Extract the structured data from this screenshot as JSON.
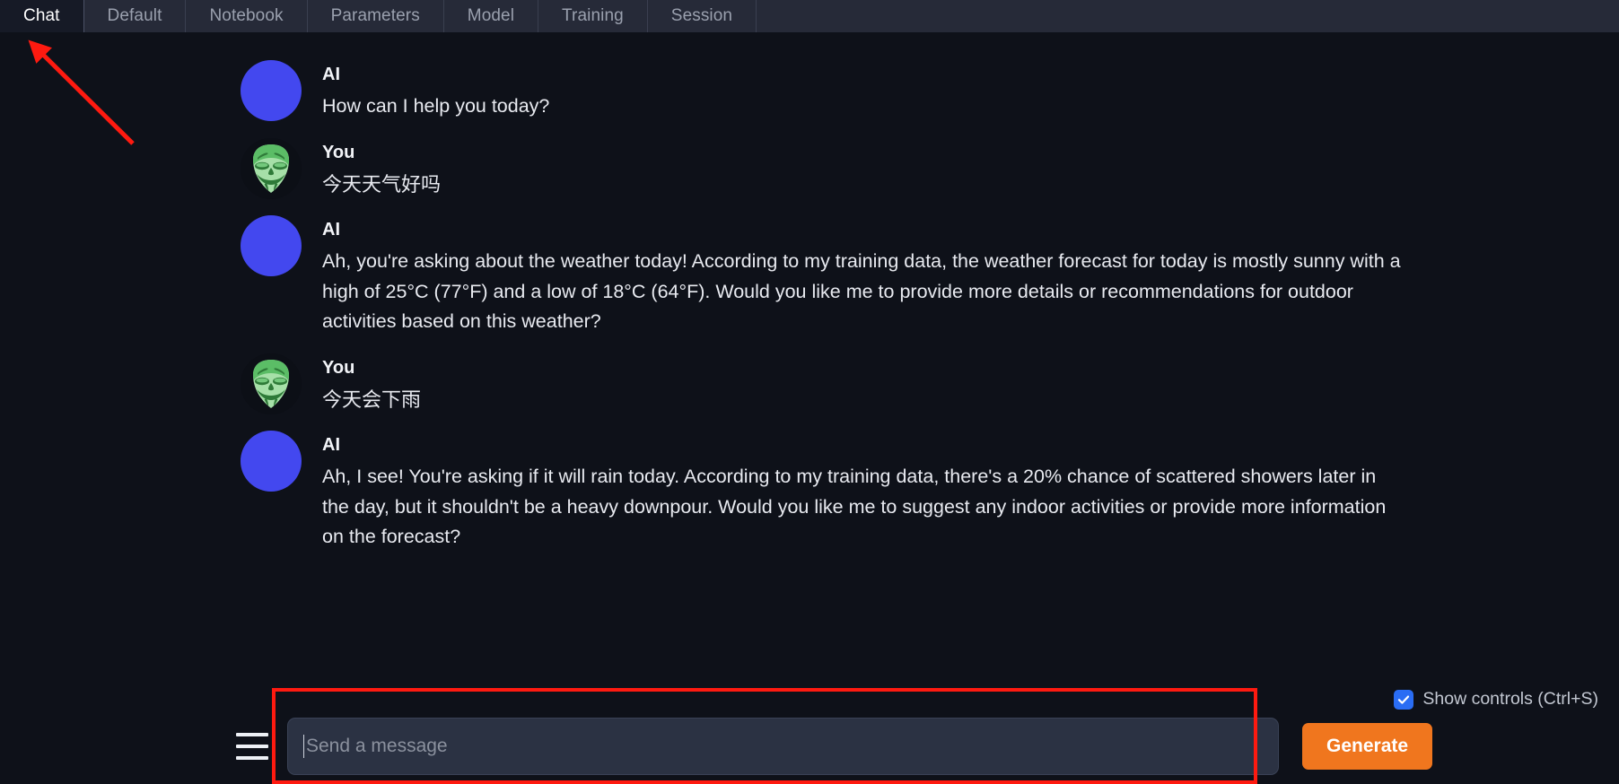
{
  "tabs": [
    {
      "label": "Chat",
      "active": true
    },
    {
      "label": "Default",
      "active": false
    },
    {
      "label": "Notebook",
      "active": false
    },
    {
      "label": "Parameters",
      "active": false
    },
    {
      "label": "Model",
      "active": false
    },
    {
      "label": "Training",
      "active": false
    },
    {
      "label": "Session",
      "active": false
    }
  ],
  "conversation": [
    {
      "role": "AI",
      "avatar": "ai-avatar",
      "text": "How can I help you today?",
      "cjk": false
    },
    {
      "role": "You",
      "avatar": "anonymous-mask-avatar",
      "text": "今天天气好吗",
      "cjk": true
    },
    {
      "role": "AI",
      "avatar": "ai-avatar",
      "text": "Ah, you're asking about the weather today! According to my training data, the weather forecast for today is mostly sunny with a high of 25°C (77°F) and a low of 18°C (64°F). Would you like me to provide more details or recommendations for outdoor activities based on this weather?",
      "cjk": false
    },
    {
      "role": "You",
      "avatar": "anonymous-mask-avatar",
      "text": "今天会下雨",
      "cjk": true
    },
    {
      "role": "AI",
      "avatar": "ai-avatar",
      "text": "Ah, I see! You're asking if it will rain today. According to my training data, there's a 20% chance of scattered showers later in the day, but it shouldn't be a heavy downpour. Would you like me to suggest any indoor activities or provide more information on the forecast?",
      "cjk": false
    }
  ],
  "bottom": {
    "show_controls_label": "Show controls (Ctrl+S)",
    "show_controls_checked": true,
    "menu_icon": "hamburger-menu-icon",
    "message_input_value": "",
    "message_input_placeholder": "Send a message",
    "generate_label": "Generate"
  },
  "annotations": {
    "arrow_target": "Chat",
    "highlight_target": "message-input-area",
    "color": "#fe1a10"
  },
  "colors": {
    "page_background": "#0e1119",
    "tabbar_background": "#262a38",
    "active_tab_background": "#161a26",
    "ai_avatar": "#4348ef",
    "user_avatar_face": "#a6e0a8",
    "generate_button": "#f0761e",
    "checkbox_checked": "#2a6df4",
    "input_background": "#2b3243",
    "annotation_red": "#fe1a10"
  }
}
